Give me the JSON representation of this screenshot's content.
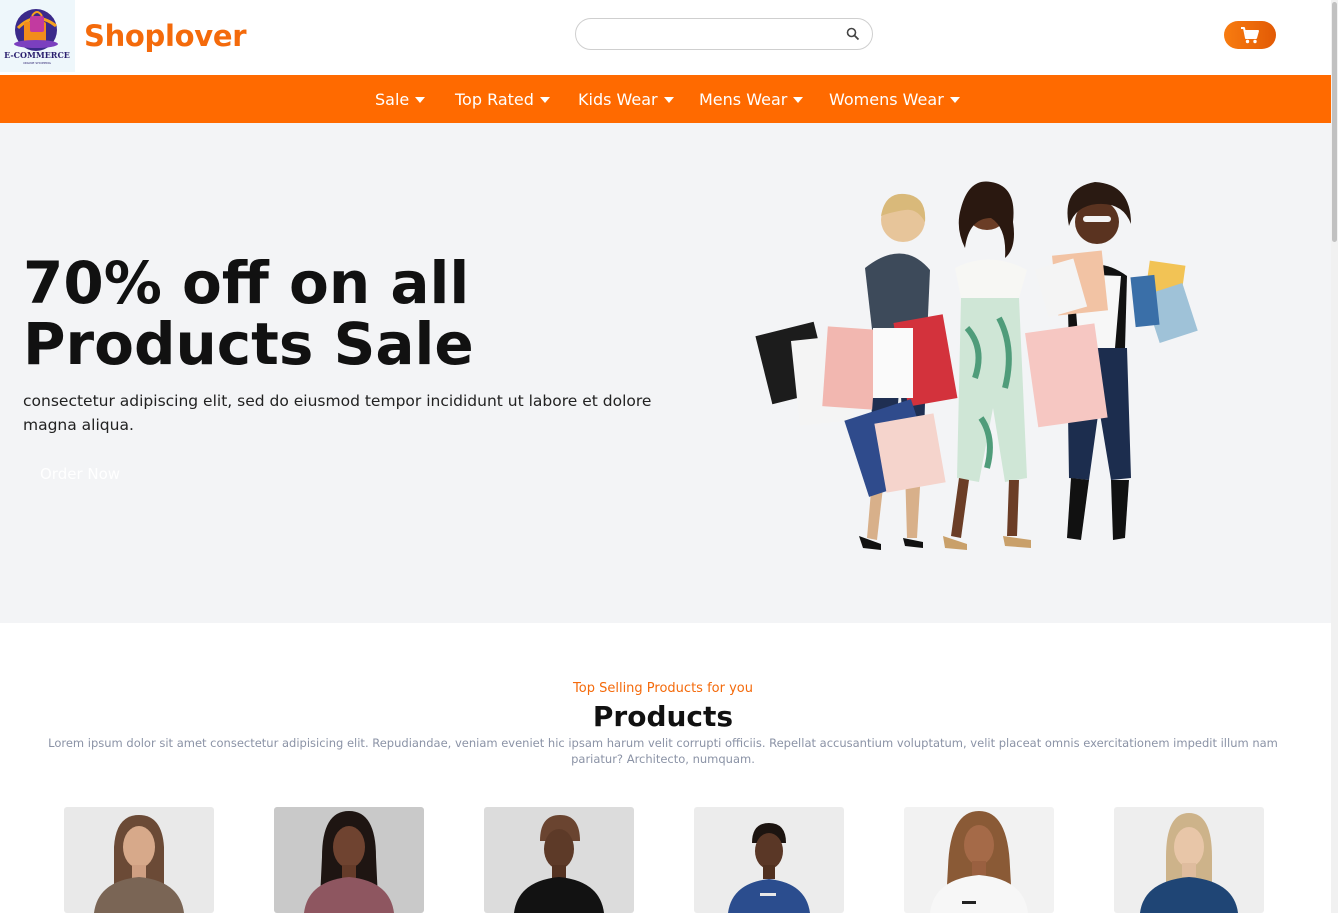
{
  "header": {
    "logo": {
      "text": "E-COMMERCE",
      "subtext": "ONLINE SHOPPING"
    },
    "brand": "Shoplover",
    "search": {
      "placeholder": "",
      "value": "",
      "icon": "search-icon"
    },
    "cart": {
      "icon": "cart-icon"
    }
  },
  "nav": {
    "items": [
      {
        "label": "Sale",
        "icon": "caret-down-icon"
      },
      {
        "label": "Top Rated",
        "icon": "caret-down-icon"
      },
      {
        "label": "Kids Wear",
        "icon": "caret-down-icon"
      },
      {
        "label": "Mens Wear",
        "icon": "caret-down-icon"
      },
      {
        "label": "Womens Wear",
        "icon": "caret-down-icon"
      }
    ]
  },
  "hero": {
    "headline_line1": "70% off on all",
    "headline_line2": "Products Sale",
    "text": "consectetur adipiscing elit, sed do eiusmod tempor incididunt ut labore et dolore magna aliqua.",
    "button": "Order Now"
  },
  "products": {
    "subtitle": "Top Selling Products for you",
    "title": "Products",
    "description": "Lorem ipsum dolor sit amet consectetur adipisicing elit. Repudiandae, veniam eveniet hic ipsam harum velit corrupti officiis. Repellat accusantium voluptatum, velit placeat omnis exercitationem impedit illum nam pariatur? Architecto, numquam.",
    "items": [
      {
        "shirt_color": "#7a6555",
        "bg": "#e9e9e9"
      },
      {
        "shirt_color": "#8e5660",
        "bg": "#c9c9c9"
      },
      {
        "shirt_color": "#121212",
        "bg": "#dcdcdc"
      },
      {
        "shirt_color": "#2b4d8e",
        "bg": "#ececec"
      },
      {
        "shirt_color": "#f7f7f7",
        "bg": "#f2f2f2"
      },
      {
        "shirt_color": "#1f4575",
        "bg": "#eeeeee"
      }
    ]
  },
  "colors": {
    "accent": "#ff6a00",
    "brand": "#f46a0b",
    "hero_bg": "#f3f4f6"
  }
}
